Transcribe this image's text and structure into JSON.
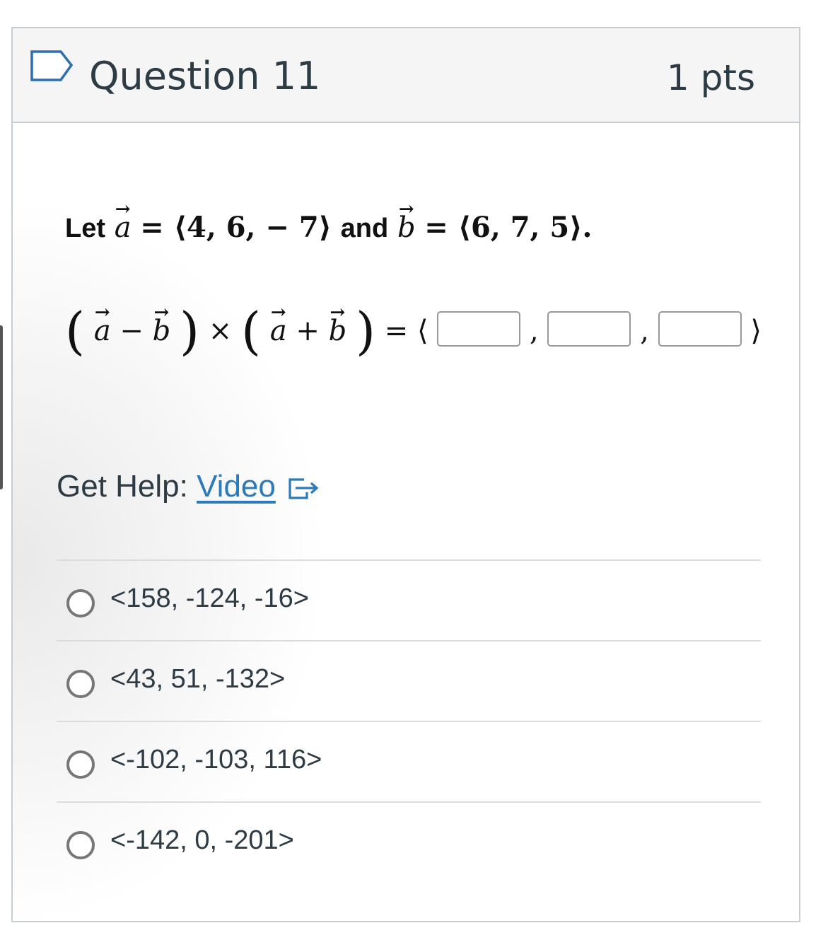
{
  "question": {
    "title": "Question 11",
    "points": "1 pts"
  },
  "statement": {
    "let": "Let",
    "vec_a": "a",
    "eq_a": "= ⟨4, 6,  − 7⟩",
    "and": "and",
    "vec_b": "b",
    "eq_b": "= ⟨6, 7, 5⟩."
  },
  "expression": {
    "lparen": "(",
    "rparen": ")",
    "minus": "−",
    "plus": "+",
    "times": "×",
    "vec_a": "a",
    "vec_b": "b",
    "equals_open": "= ⟨",
    "comma": ",",
    "close": "⟩",
    "answer_boxes": [
      "",
      "",
      ""
    ]
  },
  "help": {
    "label": "Get Help:",
    "link": "Video"
  },
  "options": [
    "<158, -124, -16>",
    "<43, 51, -132>",
    "<-102, -103, 116>",
    "<-142, 0, -201>"
  ],
  "icons": [
    "flag-icon",
    "external-link-icon"
  ]
}
